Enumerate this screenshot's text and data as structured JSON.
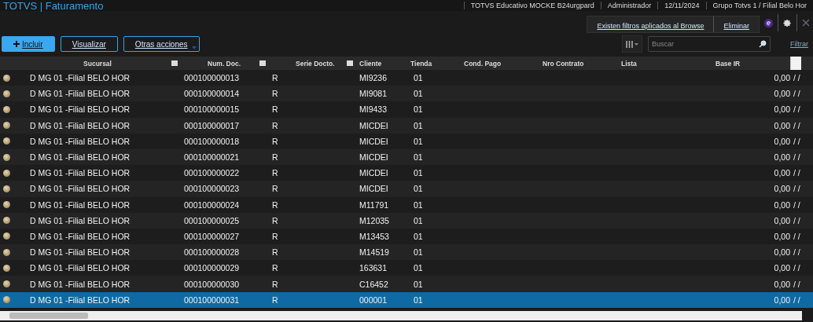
{
  "app_title": "TOTVS | Faturamento",
  "session_info": [
    "TOTVS Educativo MOCKE B24urgpard",
    "Administrador",
    "12/11/2024",
    "Grupo Totvs 1 / Filial Belo Hor"
  ],
  "filter_notice": {
    "message": "Existen filtros aplicados al Browse",
    "action": "Eliminar"
  },
  "toolbar": {
    "buttons": [
      {
        "label": "Incluir",
        "kind": "primary"
      },
      {
        "label": "Visualizar",
        "kind": "outline"
      },
      {
        "label": "Otras acciones",
        "kind": "menu"
      }
    ],
    "search": {
      "placeholder": "Buscar"
    },
    "filter_link": "Filtrar"
  },
  "table": {
    "columns": [
      {
        "label": "Sucursal",
        "sortable": true
      },
      {
        "label": "Num. Doc.",
        "sortable": true
      },
      {
        "label": "Serie Docto.",
        "sortable": true
      },
      {
        "label": "Cliente",
        "sortable": false
      },
      {
        "label": "Tienda",
        "sortable": false
      },
      {
        "label": "Cond. Pago",
        "sortable": false
      },
      {
        "label": "Nro Contrato",
        "sortable": false
      },
      {
        "label": "Lista",
        "sortable": false
      },
      {
        "label": "Base IR",
        "sortable": false
      }
    ],
    "rows": [
      {
        "selected": false,
        "cells": [
          "D MG 01 -Filial BELO HOR",
          "000100000013",
          "R",
          "MI9236",
          "01",
          "",
          "",
          "",
          "0,00",
          "/ /"
        ]
      },
      {
        "selected": false,
        "cells": [
          "D MG 01 -Filial BELO HOR",
          "000100000014",
          "R",
          "MI9081",
          "01",
          "",
          "",
          "",
          "0,00",
          "/ /"
        ]
      },
      {
        "selected": false,
        "cells": [
          "D MG 01 -Filial BELO HOR",
          "000100000015",
          "R",
          "MI9433",
          "01",
          "",
          "",
          "",
          "0,00",
          "/ /"
        ]
      },
      {
        "selected": false,
        "cells": [
          "D MG 01 -Filial BELO HOR",
          "000100000017",
          "R",
          "MICDEI",
          "01",
          "",
          "",
          "",
          "0,00",
          "/ /"
        ]
      },
      {
        "selected": false,
        "cells": [
          "D MG 01 -Filial BELO HOR",
          "000100000018",
          "R",
          "MICDEI",
          "01",
          "",
          "",
          "",
          "0,00",
          "/ /"
        ]
      },
      {
        "selected": false,
        "cells": [
          "D MG 01 -Filial BELO HOR",
          "000100000021",
          "R",
          "MICDEI",
          "01",
          "",
          "",
          "",
          "0,00",
          "/ /"
        ]
      },
      {
        "selected": false,
        "cells": [
          "D MG 01 -Filial BELO HOR",
          "000100000022",
          "R",
          "MICDEI",
          "01",
          "",
          "",
          "",
          "0,00",
          "/ /"
        ]
      },
      {
        "selected": false,
        "cells": [
          "D MG 01 -Filial BELO HOR",
          "000100000023",
          "R",
          "MICDEI",
          "01",
          "",
          "",
          "",
          "0,00",
          "/ /"
        ]
      },
      {
        "selected": false,
        "cells": [
          "D MG 01 -Filial BELO HOR",
          "000100000024",
          "R",
          "M11791",
          "01",
          "",
          "",
          "",
          "0,00",
          "/ /"
        ]
      },
      {
        "selected": false,
        "cells": [
          "D MG 01 -Filial BELO HOR",
          "000100000025",
          "R",
          "M12035",
          "01",
          "",
          "",
          "",
          "0,00",
          "/ /"
        ]
      },
      {
        "selected": false,
        "cells": [
          "D MG 01 -Filial BELO HOR",
          "000100000027",
          "R",
          "M13453",
          "01",
          "",
          "",
          "",
          "0,00",
          "/ /"
        ]
      },
      {
        "selected": false,
        "cells": [
          "D MG 01 -Filial BELO HOR",
          "000100000028",
          "R",
          "M14519",
          "01",
          "",
          "",
          "",
          "0,00",
          "/ /"
        ]
      },
      {
        "selected": false,
        "cells": [
          "D MG 01 -Filial BELO HOR",
          "000100000029",
          "R",
          "163631",
          "01",
          "",
          "",
          "",
          "0,00",
          "/ /"
        ]
      },
      {
        "selected": false,
        "cells": [
          "D MG 01 -Filial BELO HOR",
          "000100000030",
          "R",
          "C16452",
          "01",
          "",
          "",
          "",
          "0,00",
          "/ /"
        ]
      },
      {
        "selected": true,
        "cells": [
          "D MG 01 -Filial BELO HOR",
          "000100000031",
          "R",
          "000001",
          "01",
          "",
          "",
          "",
          "0,00",
          "/ /"
        ]
      }
    ]
  }
}
